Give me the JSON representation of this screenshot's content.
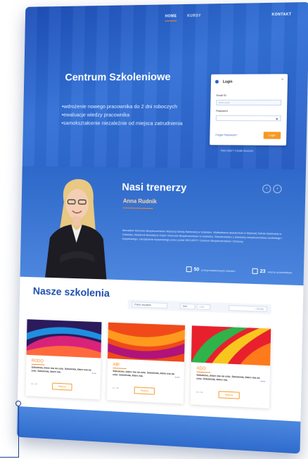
{
  "nav": {
    "home": "HOME",
    "kursy": "KURSY",
    "kontakt": "KONTAKT"
  },
  "hero": {
    "title": "Centrum Szkoleniowe",
    "bullets": [
      "wdrożenie nowego pracownika do 2 dni roboczych",
      "ewaluacje wiedzy pracownika",
      "samokształcenie niezależnie od miejsca zatrudnienia"
    ]
  },
  "login": {
    "title": "Login",
    "email_label": "Email ID",
    "email_placeholder": "Enter email",
    "password_label": "Password",
    "forgot": "Forgot Password?",
    "button": "Login",
    "create": "New User? Create Account"
  },
  "trainers": {
    "title": "Nasi trenerzy",
    "name": "Anna Rudnik",
    "description": "Menadżer Kierunku Bezpieczeństwo Wyższej Szkoły Bankowej w Gdańsku. Wykładowca akademicki w Wyższej Szkole Bankowej w Gdańsku, Akademii Morskiej w Gdyni. Kierunek Bezpieczeństwo w Gdańsku. Szkoleniowiec z dziedziny bezpieczeństwa osobistego i kryzysowego, zarządzania kryzysowego przez portal SECURITY Centrum Bezpieczeństwa i Ochrony.",
    "stat1_value": "50",
    "stat1_label": "przeprowadzonych szkoleń",
    "stat2_value": "23",
    "stat2_label": "ocena uczestników"
  },
  "courses": {
    "title": "Nasze szkolenia",
    "filter_placeholder": "Pokaż wszystkie",
    "filter_grid": "Grid",
    "filter_list": "Lista",
    "search": "Szukaj",
    "cards": [
      {
        "title": "RODO",
        "desc": "Szkolenia, które ma na celu. Szkolenia, które ma na celu. Szkolenia, które ma.",
        "button": "Więcej",
        "meta": "1h  •  40"
      },
      {
        "title": "ABI",
        "desc": "Szkolenie, które ma na celu. Szkolenia, które ma na celu. Szkolenia, które ma.",
        "button": "Więcej",
        "meta": "1h  •  40"
      },
      {
        "title": "ADO",
        "desc": "Szkolenie, które ma na celu. Szkolenia, które ma na celu. Szkolenia, które ma.",
        "button": "Więcej",
        "meta": "1h  •  40"
      }
    ]
  },
  "colors": {
    "brand_blue": "#2a5fc6",
    "accent_orange": "#f28c28"
  }
}
